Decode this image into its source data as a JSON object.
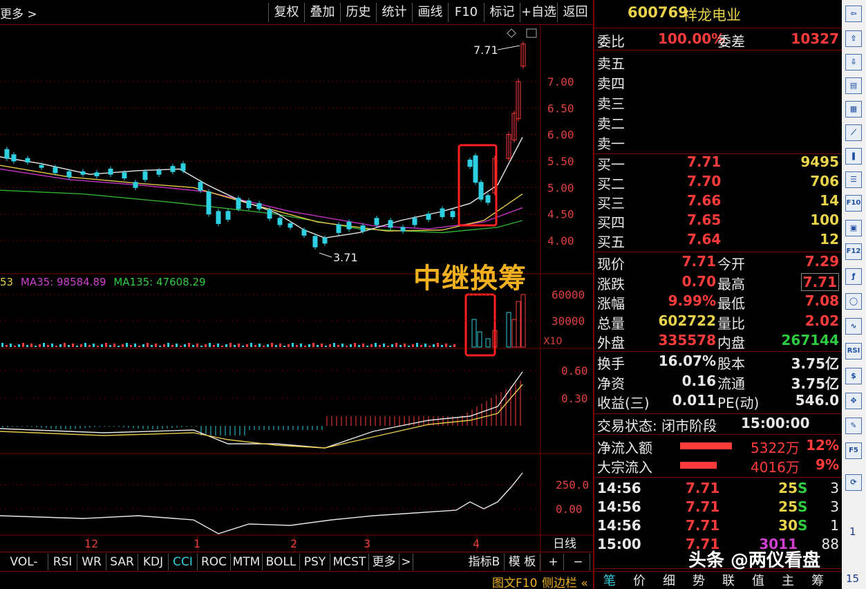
{
  "toolbar": {
    "more_label": "更多 >",
    "buttons": [
      "复权",
      "叠加",
      "历史",
      "统计",
      "画线",
      "F10",
      "标记",
      "+自选",
      "返回"
    ]
  },
  "chart": {
    "price_ticks": [
      "7.00",
      "6.50",
      "6.00",
      "5.50",
      "5.00",
      "4.50",
      "4.00"
    ],
    "high_label": "7.71",
    "low_label": "3.71",
    "annotation": "中继换筹",
    "ma_legend": {
      "ma_a": "53",
      "ma35": "MA35: 98584.89",
      "ma135": "MA135: 47608.29"
    },
    "vol_ticks": [
      "60000",
      "30000"
    ],
    "vol_unit": "X10",
    "macd_ticks": [
      "0.60",
      "0.30"
    ],
    "cci_ticks": [
      "250.0",
      "0.00"
    ],
    "date_ticks": [
      "12",
      "1",
      "2",
      "3",
      "4"
    ],
    "period": "日线",
    "colors": {
      "up": "#ff3b3b",
      "down": "#2ecfe0",
      "ma_white": "#e8e8e8",
      "ma_yellow": "#e8c84a",
      "ma_purple": "#c030c0",
      "ma_green": "#30b030",
      "box": "#ff2020",
      "annotation": "#f0b020"
    }
  },
  "indicator_tabs": [
    "VOL-TDX",
    "RSI",
    "WR",
    "SAR",
    "KDJ",
    "CCI",
    "ROC",
    "MTM",
    "BOLL",
    "PSY",
    "MCST",
    "更多",
    ">"
  ],
  "indicator_right": [
    "指标B",
    "模 板",
    "+",
    "−"
  ],
  "bottom_links": {
    "f10": "图文F10",
    "sidebar": "侧边栏 «"
  },
  "panel": {
    "code": "600769",
    "name": "祥龙电业",
    "weibi_label": "委比",
    "weibi": "100.00%",
    "weicha_label": "委差",
    "weicha": "10327",
    "sell": [
      {
        "label": "卖五"
      },
      {
        "label": "卖四"
      },
      {
        "label": "卖三"
      },
      {
        "label": "卖二"
      },
      {
        "label": "卖一"
      }
    ],
    "buy": [
      {
        "label": "买一",
        "price": "7.71",
        "vol": "9495"
      },
      {
        "label": "买二",
        "price": "7.70",
        "vol": "706"
      },
      {
        "label": "买三",
        "price": "7.66",
        "vol": "14"
      },
      {
        "label": "买四",
        "price": "7.65",
        "vol": "100"
      },
      {
        "label": "买五",
        "price": "7.64",
        "vol": "12"
      }
    ],
    "quote": [
      {
        "l1": "现价",
        "v1": "7.71",
        "l2": "今开",
        "v2": "7.29"
      },
      {
        "l1": "涨跌",
        "v1": "0.70",
        "l2": "最高",
        "v2": "7.71"
      },
      {
        "l1": "涨幅",
        "v1": "9.99%",
        "l2": "最低",
        "v2": "7.08"
      },
      {
        "l1": "总量",
        "v1": "602722",
        "l2": "量比",
        "v2": "2.02"
      },
      {
        "l1": "外盘",
        "v1": "335578",
        "l2": "内盘",
        "v2": "267144"
      }
    ],
    "fund": [
      {
        "l1": "换手",
        "v1": "16.07%",
        "l2": "股本",
        "v2": "3.75亿"
      },
      {
        "l1": "净资",
        "v1": "0.16",
        "l2": "流通",
        "v2": "3.75亿"
      },
      {
        "l1": "收益(三)",
        "v1": "0.011",
        "l2": "PE(动)",
        "v2": "546.0"
      }
    ],
    "trade_state": "交易状态: 闭市阶段",
    "trade_time": "15:00:00",
    "flows": [
      {
        "label": "净流入额",
        "amount": "5322万",
        "pct": "12%",
        "ratio": 0.85
      },
      {
        "label": "大宗流入",
        "amount": "4016万",
        "pct": "9%",
        "ratio": 0.6
      }
    ],
    "ticks": [
      {
        "time": "14:56",
        "price": "7.71",
        "vol": "25",
        "side": "S",
        "n": "3"
      },
      {
        "time": "14:56",
        "price": "7.71",
        "vol": "25",
        "side": "S",
        "n": "3"
      },
      {
        "time": "14:56",
        "price": "7.71",
        "vol": "30",
        "side": "S",
        "n": "1"
      },
      {
        "time": "15:00",
        "price": "7.71",
        "vol": "3011",
        "side": "",
        "n": "88"
      }
    ],
    "bottom_tabs": [
      "笔",
      "价",
      "细",
      "势",
      "联",
      "值",
      "主",
      "筹"
    ]
  },
  "sidebar": {
    "icons": [
      "arrow-left-icon",
      "arrow-up-icon",
      "arrow-down-icon",
      "report-icon",
      "grid-icon",
      "line-chart-icon",
      "candle-icon",
      "list-icon",
      "f10-icon",
      "doc-icon",
      "f12-icon",
      "fx-icon",
      "circle-icon",
      "wave-icon",
      "rsi-icon",
      "dollar-icon",
      "move-icon",
      "pencil-icon",
      "f5-icon",
      "refresh-icon"
    ],
    "rsi_text": "RSI",
    "f10_text": "F10",
    "f12_text": "F12",
    "f5_text": "F5",
    "num1": "1",
    "num15": "15"
  },
  "watermark": "头条 @两仪看盘"
}
